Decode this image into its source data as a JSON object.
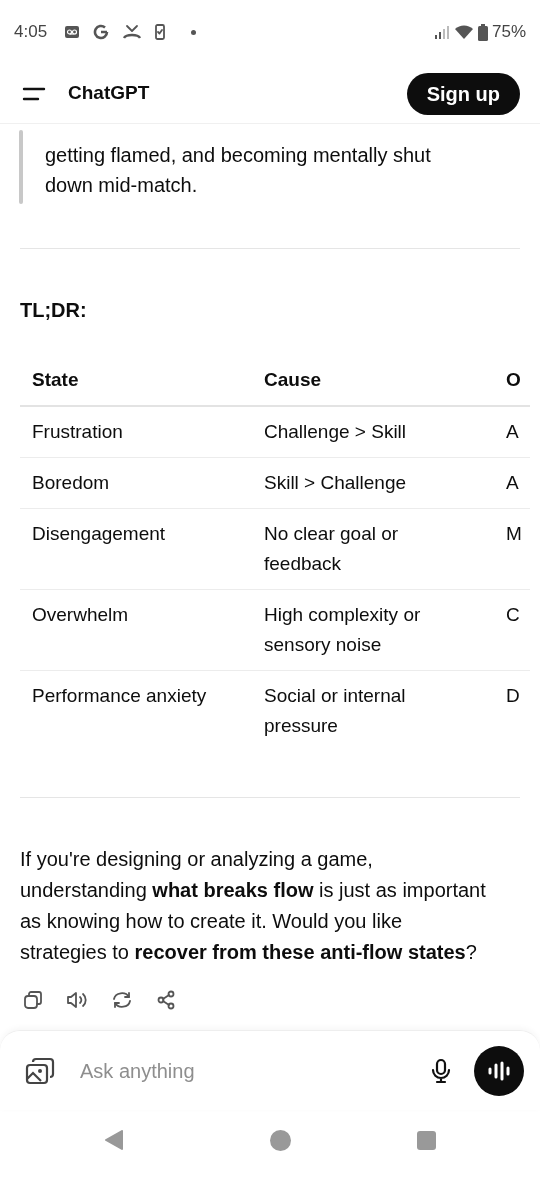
{
  "status_bar": {
    "time": "4:05",
    "battery": "75%"
  },
  "header": {
    "title": "ChatGPT",
    "sign_up": "Sign up"
  },
  "quote": "getting flamed, and becoming mentally shut down mid-match.",
  "heading": "TL;DR:",
  "table": {
    "columns": [
      "State",
      "Cause",
      "O"
    ],
    "rows": [
      [
        "Frustration",
        "Challenge > Skill",
        "A"
      ],
      [
        "Boredom",
        "Skill > Challenge",
        "A"
      ],
      [
        "Disengagement",
        "No clear goal or feedback",
        "M"
      ],
      [
        "Overwhelm",
        "High complexity or sensory noise",
        "C"
      ],
      [
        "Performance anxiety",
        "Social or internal pressure",
        "D"
      ]
    ]
  },
  "paragraph": "If you're designing or analyzing a game, understanding **what breaks flow** is just as important as knowing how to create it. Would you like strategies to **recover from these anti-flow states**?",
  "composer": {
    "placeholder": "Ask anything"
  }
}
